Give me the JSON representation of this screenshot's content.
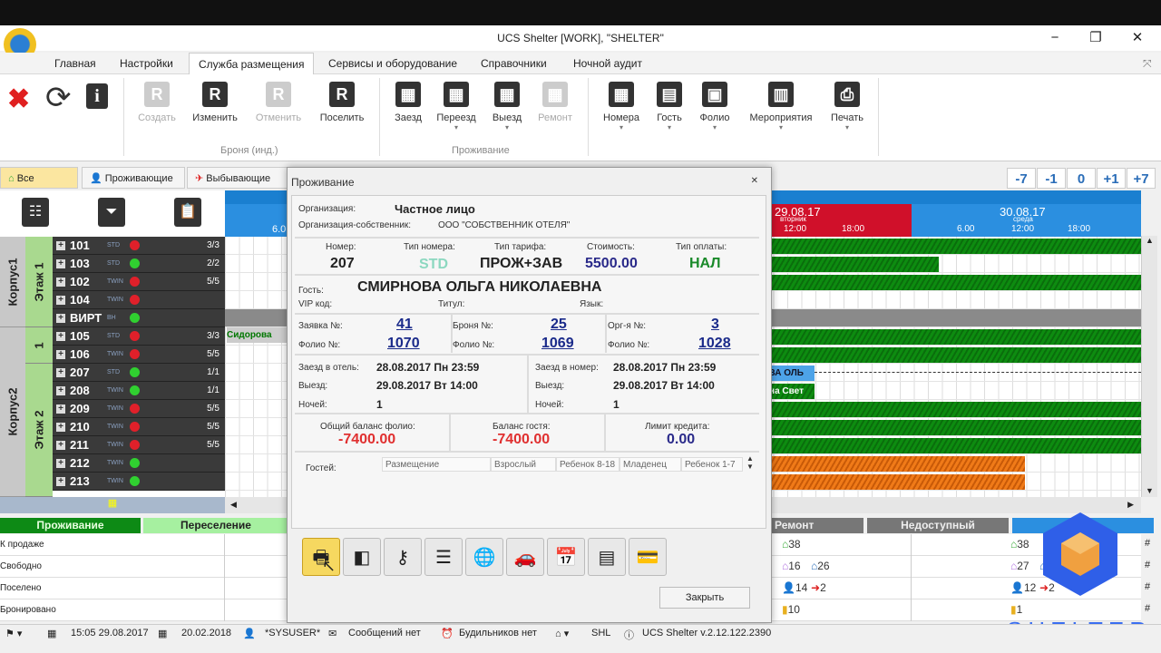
{
  "window": {
    "title": "UCS Shelter [WORK], \"SHELTER\"",
    "minimize": "−",
    "restore": "❐",
    "close": "✕"
  },
  "menu": [
    "Главная",
    "Настройки",
    "Служба размещения",
    "Сервисы и оборудование",
    "Справочники",
    "Ночной аудит"
  ],
  "ribbon": {
    "quick": [
      {
        "name": "delete",
        "icon": "✖"
      },
      {
        "name": "refresh",
        "icon": "⟳"
      },
      {
        "name": "info",
        "icon": "i"
      }
    ],
    "booking_group": "Броня (инд.)",
    "booking": [
      {
        "label": "Создать",
        "disabled": true
      },
      {
        "label": "Изменить"
      },
      {
        "label": "Отменить",
        "disabled": true
      },
      {
        "label": "Поселить"
      }
    ],
    "stay_group": "Проживание",
    "stay": [
      {
        "label": "Заезд"
      },
      {
        "label": "Переезд"
      },
      {
        "label": "Выезд"
      },
      {
        "label": "Ремонт",
        "disabled": true
      }
    ],
    "other": [
      {
        "label": "Номера"
      },
      {
        "label": "Гость"
      },
      {
        "label": "Фолио"
      },
      {
        "label": "Мероприятия"
      },
      {
        "label": "Печать"
      }
    ]
  },
  "filters": [
    "Все",
    "Проживающие",
    "Выбывающие"
  ],
  "day_nav": [
    "-7",
    "-1",
    "0",
    "+1",
    "+7"
  ],
  "timeline": {
    "left_tick": "6.0",
    "day1": {
      "date": "29.08.17",
      "weekday": "вторник",
      "ticks": [
        "12:00",
        "18:00"
      ]
    },
    "day2": {
      "date": "30.08.17",
      "weekday": "среда",
      "ticks": [
        "6.00",
        "12:00",
        "18:00"
      ]
    },
    "bar_labels": {
      "left": "Сидорова",
      "r207": "ВА ОЛЬ",
      "r208": "на Свет"
    }
  },
  "buildings": [
    {
      "name": "Корпус1",
      "floors": [
        {
          "name": "Этаж 1"
        }
      ]
    },
    {
      "name": "Корпус2",
      "floors": [
        {
          "name": "1"
        },
        {
          "name": "Этаж 2"
        }
      ]
    }
  ],
  "rooms": [
    {
      "num": "101",
      "type": "STD",
      "status": "busy",
      "occ": "3/3"
    },
    {
      "num": "103",
      "type": "STD",
      "status": "free",
      "occ": "2/2"
    },
    {
      "num": "102",
      "type": "TWIN",
      "status": "busy",
      "occ": "5/5"
    },
    {
      "num": "104",
      "type": "TWIN",
      "status": "busy",
      "occ": ""
    },
    {
      "num": "ВИРТ",
      "type": "ВН",
      "status": "free",
      "occ": ""
    },
    {
      "num": "105",
      "type": "STD",
      "status": "busy",
      "occ": "3/3"
    },
    {
      "num": "106",
      "type": "TWIN",
      "status": "busy",
      "occ": "5/5"
    },
    {
      "num": "207",
      "type": "STD",
      "status": "free",
      "occ": "1/1"
    },
    {
      "num": "208",
      "type": "TWIN",
      "status": "free",
      "occ": "1/1"
    },
    {
      "num": "209",
      "type": "TWIN",
      "status": "busy",
      "occ": "5/5"
    },
    {
      "num": "210",
      "type": "TWIN",
      "status": "busy",
      "occ": "5/5"
    },
    {
      "num": "211",
      "type": "TWIN",
      "status": "busy",
      "occ": "5/5"
    },
    {
      "num": "212",
      "type": "TWIN",
      "status": "free",
      "occ": ""
    },
    {
      "num": "213",
      "type": "TWIN",
      "status": "free",
      "occ": ""
    }
  ],
  "colors": {
    "busy": "#e0202a",
    "free": "#30d030"
  },
  "legend": [
    "Проживание",
    "Переселение",
    "Ремонт",
    "Недоступный"
  ],
  "summary": {
    "rows": [
      "К продаже",
      "Свободно",
      "Поселено",
      "Бронировано"
    ],
    "col1": [
      [
        "38"
      ],
      [
        "16",
        "26"
      ],
      [
        "14",
        "2"
      ],
      [
        "10"
      ]
    ],
    "col2": [
      [
        "38"
      ],
      [
        "27",
        "2"
      ],
      [
        "12",
        "2"
      ],
      [
        "1"
      ]
    ]
  },
  "dialog": {
    "title": "Проживание",
    "close": "✕",
    "org_label": "Организация:",
    "org": "Частное лицо",
    "owner_label": "Организация-собственник:",
    "owner": "ООО \"СОБСТВЕННИК ОТЕЛЯ\"",
    "room_label": "Номер:",
    "room": "207",
    "room_type_label": "Тип номера:",
    "room_type": "STD",
    "rate_label": "Тип тарифа:",
    "rate": "ПРОЖ+ЗАВ",
    "cost_label": "Стоимость:",
    "cost": "5500.00",
    "pay_label": "Тип оплаты:",
    "pay": "НАЛ",
    "guest_label": "Гость:",
    "guest": "СМИРНОВА ОЛЬГА НИКОЛАЕВНА",
    "vip_label": "VIP код:",
    "title_label": "Титул:",
    "lang_label": "Язык:",
    "req_label": "Заявка №:",
    "req": "41",
    "folio_label": "Фолио №:",
    "req_folio": "1070",
    "book_label": "Броня №:",
    "book": "25",
    "book_folio": "1069",
    "org_no_label": "Орг-я №:",
    "org_no": "3",
    "org_folio": "1028",
    "hotel_in_label": "Заезд в отель:",
    "hotel_in": "28.08.2017 Пн 23:59",
    "out_label": "Выезд:",
    "hotel_out": "29.08.2017 Вт 14:00",
    "nights_label": "Ночей:",
    "nights": "1",
    "room_in_label": "Заезд в номер:",
    "room_in": "28.08.2017 Пн 23:59",
    "room_out": "29.08.2017 Вт 14:00",
    "room_nights": "1",
    "total_label": "Общий баланс фолио:",
    "total": "-7400.00",
    "guest_bal_label": "Баланс гостя:",
    "guest_bal": "-7400.00",
    "limit_label": "Лимит кредита:",
    "limit": "0.00",
    "guests_label": "Гостей:",
    "guest_cols": [
      "Размещение",
      "Взрослый",
      "Ребенок 8-18",
      "Младенец",
      "Ребенок 1-7"
    ],
    "actions": [
      {
        "name": "print",
        "icon": "🖶"
      },
      {
        "name": "layout",
        "icon": "◧"
      },
      {
        "name": "key",
        "icon": "⚷"
      },
      {
        "name": "checklist",
        "icon": "☰"
      },
      {
        "name": "globe",
        "icon": "🌐"
      },
      {
        "name": "car",
        "icon": "🚗"
      },
      {
        "name": "calendar-person",
        "icon": "📅"
      },
      {
        "name": "card",
        "icon": "▤"
      },
      {
        "name": "wallet",
        "icon": "💳"
      }
    ],
    "close_button": "Закрыть"
  },
  "status": {
    "date": "15:05 29.08.2017",
    "date2": "20.02.2018",
    "user": "*SYSUSER*",
    "messages": "Сообщений нет",
    "alarms": "Будильников нет",
    "hotel": "SHL",
    "version": "UCS Shelter v.2.12.122.2390"
  },
  "watermark": "SHELTER"
}
